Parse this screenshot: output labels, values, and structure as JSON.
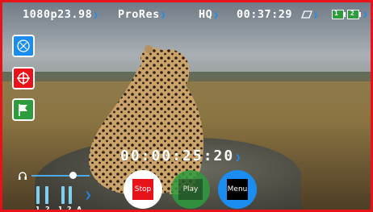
{
  "status": {
    "format": "1080p23.98",
    "codec": "ProRes",
    "quality": "HQ",
    "remaining_time": "00:37:29",
    "media_slots": [
      "1",
      "2"
    ]
  },
  "timecode": "00:00:25:20",
  "controls": {
    "stop_label": "Stop",
    "play_label": "Play",
    "menu_label": "Menu"
  },
  "audio": {
    "channel_labels": [
      "1",
      "2",
      "1",
      "2",
      "A"
    ],
    "volume_level": 0.72
  },
  "colors": {
    "border": "#e8131a",
    "accent": "#1b8cf0",
    "stop": "#e8131a",
    "play": "#2e9b3e",
    "menu": "#1b8cf0",
    "flag": "#2e9b3e"
  },
  "icons": {
    "left_top": "display-icon",
    "left_mid": "crosshair-icon",
    "left_bottom": "flag-icon",
    "headphones": "headphones-icon",
    "storage": "battery-icon"
  }
}
